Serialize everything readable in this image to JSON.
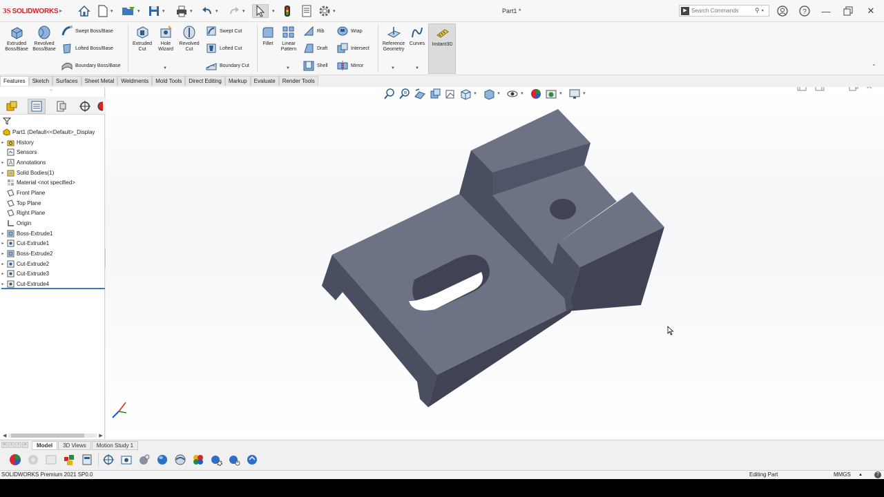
{
  "app": {
    "logo_ds": "3S",
    "logo_text": "SOLIDWORKS",
    "document_title": "Part1 *",
    "search_placeholder": "Search Commands"
  },
  "ribbon": {
    "extruded_boss": "Extruded Boss/Base",
    "revolved_boss": "Revolved Boss/Base",
    "swept_boss": "Swept Boss/Base",
    "lofted_boss": "Lofted Boss/Base",
    "boundary_boss": "Boundary Boss/Base",
    "extruded_cut": "Extruded Cut",
    "hole_wizard": "Hole Wizard",
    "revolved_cut": "Revolved Cut",
    "swept_cut": "Swept Cut",
    "lofted_cut": "Lofted Cut",
    "boundary_cut": "Boundary Cut",
    "fillet": "Fillet",
    "linear_pattern": "Linear Pattern",
    "rib": "Rib",
    "draft": "Draft",
    "shell": "Shell",
    "wrap": "Wrap",
    "intersect": "Intersect",
    "mirror": "Mirror",
    "reference_geometry": "Reference Geometry",
    "curves": "Curves",
    "instant3d": "Instant3D"
  },
  "tabs": [
    {
      "label": "Features",
      "active": true
    },
    {
      "label": "Sketch"
    },
    {
      "label": "Surfaces"
    },
    {
      "label": "Sheet Metal"
    },
    {
      "label": "Weldments"
    },
    {
      "label": "Mold Tools"
    },
    {
      "label": "Direct Editing"
    },
    {
      "label": "Markup"
    },
    {
      "label": "Evaluate"
    },
    {
      "label": "Render Tools"
    }
  ],
  "tree": {
    "root": "Part1  (Default<<Default>_Display",
    "items": [
      {
        "label": "History",
        "icon": "history-folder-icon",
        "expandable": true
      },
      {
        "label": "Sensors",
        "icon": "sensors-icon",
        "expandable": false
      },
      {
        "label": "Annotations",
        "icon": "annotations-icon",
        "expandable": true
      },
      {
        "label": "Solid Bodies(1)",
        "icon": "solid-bodies-icon",
        "expandable": true
      },
      {
        "label": "Material <not specified>",
        "icon": "material-icon",
        "expandable": false
      },
      {
        "label": "Front Plane",
        "icon": "plane-icon",
        "expandable": false
      },
      {
        "label": "Top Plane",
        "icon": "plane-icon",
        "expandable": false
      },
      {
        "label": "Right Plane",
        "icon": "plane-icon",
        "expandable": false
      },
      {
        "label": "Origin",
        "icon": "origin-icon",
        "expandable": false
      },
      {
        "label": "Boss-Extrude1",
        "icon": "boss-extrude-icon",
        "expandable": true
      },
      {
        "label": "Cut-Extrude1",
        "icon": "cut-extrude-icon",
        "expandable": true
      },
      {
        "label": "Boss-Extrude2",
        "icon": "boss-extrude-icon",
        "expandable": true
      },
      {
        "label": "Cut-Extrude2",
        "icon": "cut-extrude-icon",
        "expandable": true
      },
      {
        "label": "Cut-Extrude3",
        "icon": "cut-extrude-icon",
        "expandable": true
      },
      {
        "label": "Cut-Extrude4",
        "icon": "cut-extrude-icon",
        "expandable": true
      }
    ]
  },
  "bottom_tabs": [
    {
      "label": "Model",
      "active": true
    },
    {
      "label": "3D Views"
    },
    {
      "label": "Motion Study 1"
    }
  ],
  "status": {
    "version": "SOLIDWORKS Premium 2021 SP0.0",
    "mode": "Editing Part",
    "units": "MMGS"
  },
  "colors": {
    "brand_red": "#d21f26",
    "part_top": "#6e7285",
    "part_side": "#4a4e61",
    "part_dark": "#3c3f50",
    "accent_blue": "#3a78c8"
  }
}
